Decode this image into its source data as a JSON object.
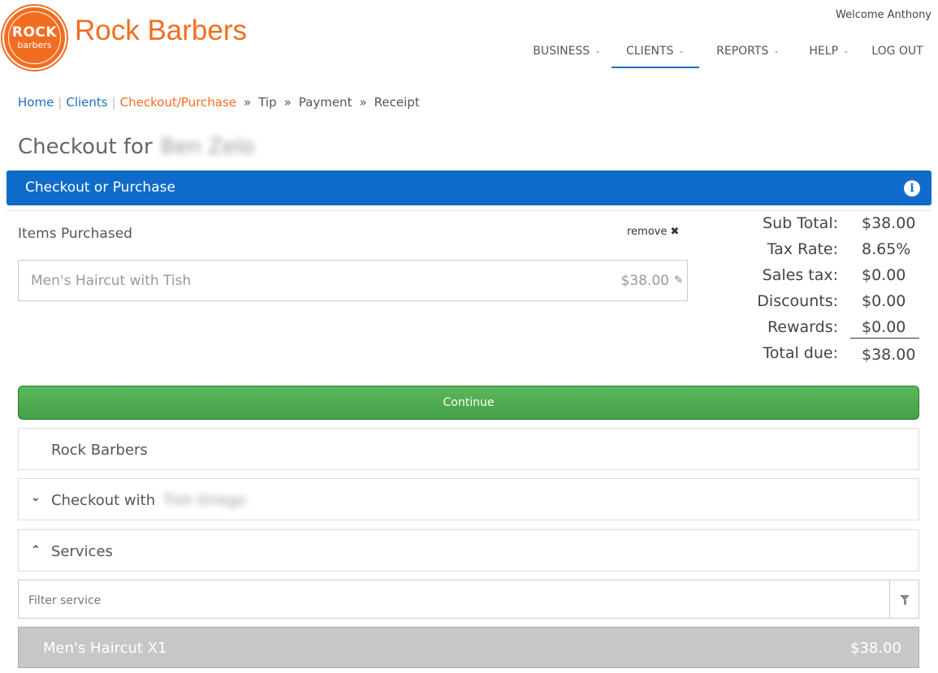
{
  "brand": {
    "logo_top": "ROCK",
    "logo_bottom": "barbers",
    "name": "Rock Barbers",
    "accent": "#f26d21"
  },
  "user": {
    "welcome": "Welcome Anthony"
  },
  "nav": {
    "business": "BUSINESS",
    "clients": "CLIENTS",
    "reports": "REPORTS",
    "help": "HELP",
    "logout": "LOG OUT"
  },
  "breadcrumb": {
    "home": "Home",
    "clients": "Clients",
    "current": "Checkout/Purchase",
    "tip": "Tip",
    "payment": "Payment",
    "receipt": "Receipt"
  },
  "page": {
    "title": "Checkout for",
    "client_name": "Ben Zelo"
  },
  "panel": {
    "title": "Checkout or Purchase",
    "color": "#0f6bc9"
  },
  "items": {
    "label": "Items Purchased",
    "remove_label": "remove",
    "list": [
      {
        "name": "Men's Haircut with Tish",
        "price": "$38.00"
      }
    ]
  },
  "totals": {
    "subtotal_label": "Sub Total:",
    "subtotal": "$38.00",
    "tax_rate_label": "Tax Rate:",
    "tax_rate": "8.65%",
    "sales_tax_label": "Sales tax:",
    "sales_tax": "$0.00",
    "discounts_label": "Discounts:",
    "discounts": "$0.00",
    "rewards_label": "Rewards:",
    "rewards": "$0.00",
    "total_label": "Total due:",
    "total": "$38.00"
  },
  "continue_label": "Continue",
  "accordion": {
    "location": "Rock Barbers",
    "checkout_with_label": "Checkout with",
    "checkout_with_name": "Tish Griego",
    "services": "Services"
  },
  "filter": {
    "placeholder": "Filter service"
  },
  "services": [
    {
      "name": "Men's Haircut X1",
      "price": "$38.00"
    }
  ]
}
